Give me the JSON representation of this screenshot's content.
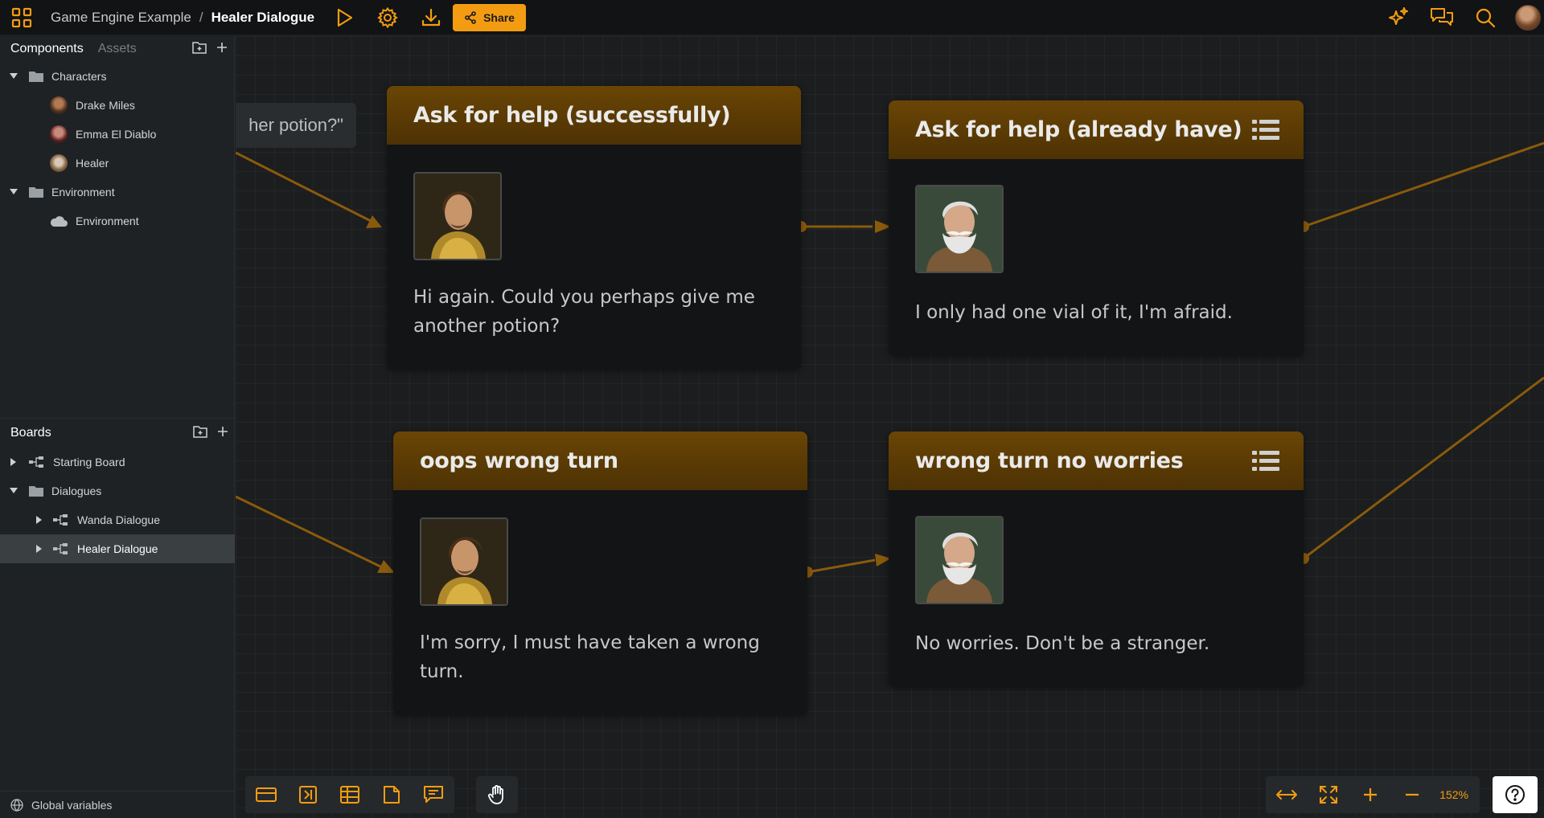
{
  "topbar": {
    "project": "Game Engine Example",
    "separator": "/",
    "board": "Healer Dialogue",
    "share_label": "Share"
  },
  "sidebar": {
    "tabs": [
      {
        "label": "Components",
        "active": true
      },
      {
        "label": "Assets",
        "active": false
      }
    ],
    "components": [
      {
        "label": "Characters",
        "type": "folder",
        "expanded": true,
        "level": 0
      },
      {
        "label": "Drake Miles",
        "type": "character",
        "level": 1
      },
      {
        "label": "Emma El Diablo",
        "type": "character",
        "level": 1
      },
      {
        "label": "Healer",
        "type": "character",
        "level": 1
      },
      {
        "label": "Environment",
        "type": "folder",
        "expanded": true,
        "level": 0
      },
      {
        "label": "Environment",
        "type": "environment",
        "level": 1
      }
    ],
    "boards_title": "Boards",
    "boards": [
      {
        "label": "Starting Board",
        "type": "board",
        "level": 0
      },
      {
        "label": "Dialogues",
        "type": "folder",
        "expanded": true,
        "level": 0
      },
      {
        "label": "Wanda Dialogue",
        "type": "board",
        "level": 1
      },
      {
        "label": "Healer Dialogue",
        "type": "board",
        "level": 1,
        "selected": true
      }
    ],
    "global_variables": "Global variables"
  },
  "canvas": {
    "partial_text": "her potion?\"",
    "nodes": [
      {
        "title": "Ask for help (successfully)",
        "speaker": "Drake Miles",
        "text": "Hi again. Could you perhaps give me another potion?",
        "has_menu": false
      },
      {
        "title": "Ask for help (already have)",
        "speaker": "Healer",
        "text": "I only had one vial of it, I'm afraid.",
        "has_menu": true
      },
      {
        "title": "oops wrong turn",
        "speaker": "Drake Miles",
        "text": "I'm sorry, I must have taken a wrong turn.",
        "has_menu": false
      },
      {
        "title": "wrong turn no worries",
        "speaker": "Healer",
        "text": "No worries. Don't be a stranger.",
        "has_menu": true
      }
    ],
    "zoom": "152%"
  },
  "colors": {
    "accent": "#f39c12",
    "edge": "#8a5a0c",
    "node_header": "#5c3c05",
    "node_body": "#121415"
  }
}
